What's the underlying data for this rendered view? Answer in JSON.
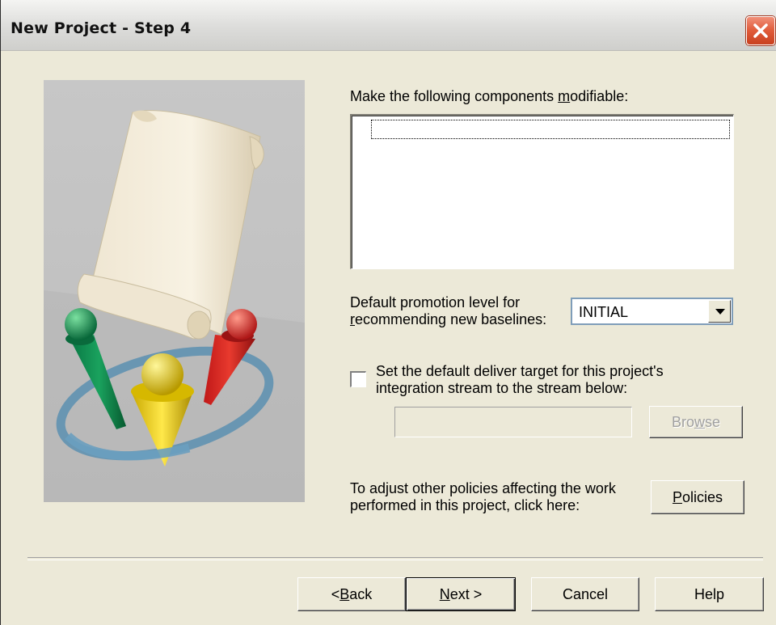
{
  "window": {
    "title": "New Project - Step 4"
  },
  "components": {
    "label_pre": "Make the following components ",
    "label_accel": "m",
    "label_post": "odifiable:",
    "items": []
  },
  "promotion": {
    "label_line1": "Default promotion level for",
    "label_line2_accel": "r",
    "label_line2_rest": "ecommending new baselines:",
    "selected": "INITIAL"
  },
  "deliver": {
    "checked": false,
    "label_line1": "Set the default deliver target for this project's",
    "label_line2": "integration stream to the stream below:",
    "stream_value": "",
    "browse_pre": "Bro",
    "browse_accel": "w",
    "browse_post": "se"
  },
  "policies": {
    "text_line1": "To adjust other policies affecting the work",
    "text_line2": "performed in this project, click here:",
    "button_accel": "P",
    "button_rest": "olicies"
  },
  "footer": {
    "back_pre": "< ",
    "back_accel": "B",
    "back_post": "ack",
    "next_accel": "N",
    "next_post": "ext >",
    "cancel": "Cancel",
    "help": "Help"
  },
  "icons": {
    "close": "close-icon",
    "dropdown": "chevron-down-icon"
  },
  "colors": {
    "dialog_bg": "#ece9d8",
    "close_button": "#e05a38",
    "illustration_bg": "#c2c2c2"
  }
}
